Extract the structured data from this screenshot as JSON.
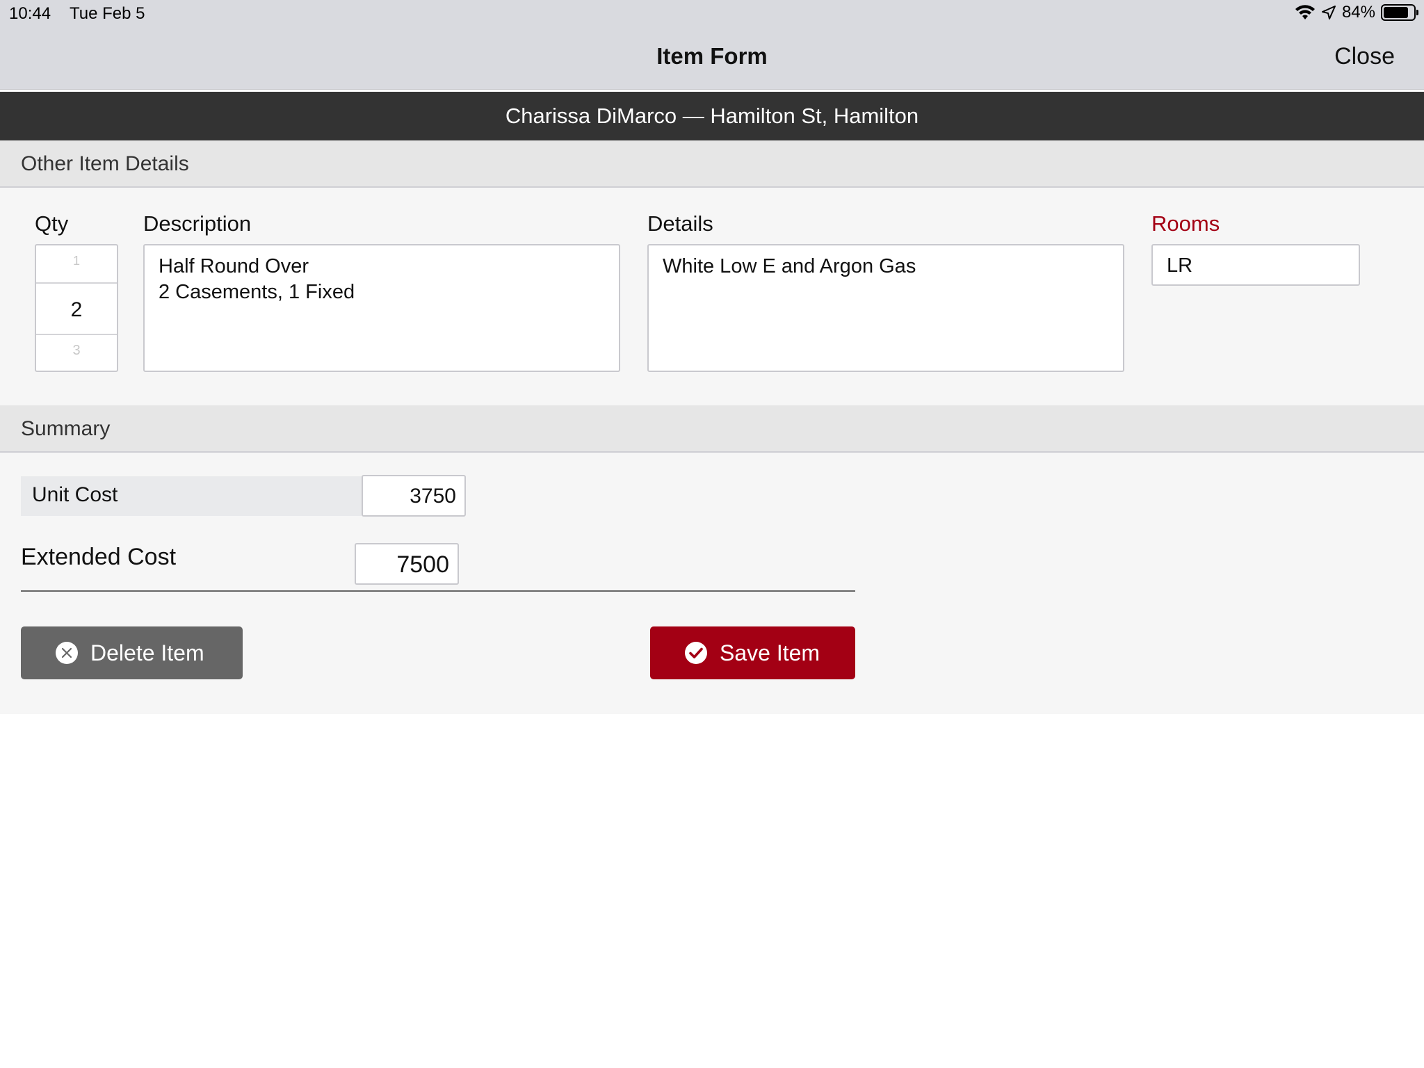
{
  "status": {
    "time": "10:44",
    "date": "Tue Feb 5",
    "battery_text": "84%",
    "battery_level": 0.84
  },
  "nav": {
    "title": "Item Form",
    "close_label": "Close"
  },
  "customer": {
    "label": "Charissa  DiMarco — Hamilton St, Hamilton"
  },
  "details_section": {
    "header": "Other Item Details",
    "qty_label": "Qty",
    "qty_prev": "1",
    "qty_value": "2",
    "qty_next": "3",
    "description_label": "Description",
    "description_value": "Half Round Over\n2 Casements, 1 Fixed",
    "details_label": "Details",
    "details_value": "White Low E and Argon Gas",
    "rooms_label": "Rooms",
    "rooms_value": "LR"
  },
  "summary_section": {
    "header": "Summary",
    "unit_cost_label": "Unit Cost",
    "unit_cost_value": "3750",
    "extended_cost_label": "Extended Cost",
    "extended_cost_value": "7500"
  },
  "actions": {
    "delete_label": "Delete Item",
    "save_label": "Save Item"
  },
  "colors": {
    "accent_red": "#a30014",
    "delete_gray": "#666666",
    "customer_bar": "#333333"
  }
}
